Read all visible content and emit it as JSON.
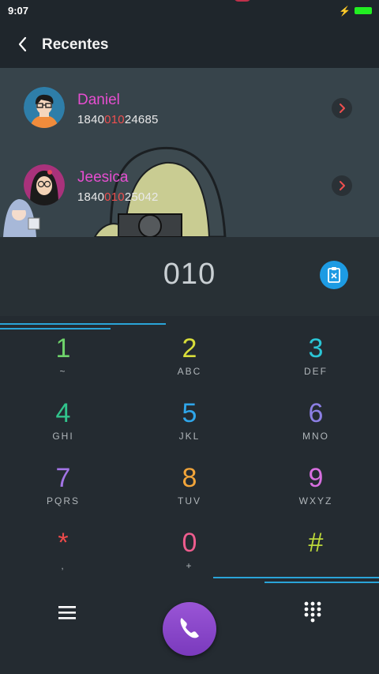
{
  "status": {
    "time": "9:07"
  },
  "header": {
    "title": "Recentes"
  },
  "contacts": [
    {
      "name": "Daniel",
      "number_pre": "1840",
      "number_match": "010",
      "number_post": "24685"
    },
    {
      "name": "Jeesica",
      "number_pre": "1840",
      "number_match": "010",
      "number_post": "25042"
    }
  ],
  "dialer": {
    "entered": "010"
  },
  "keypad": [
    {
      "digit": "1",
      "letters": "~",
      "color": "#6fd36b"
    },
    {
      "digit": "2",
      "letters": "ABC",
      "color": "#d8dd3a"
    },
    {
      "digit": "3",
      "letters": "DEF",
      "color": "#2bc6d6"
    },
    {
      "digit": "4",
      "letters": "GHI",
      "color": "#31c48c"
    },
    {
      "digit": "5",
      "letters": "JKL",
      "color": "#2fa6ea"
    },
    {
      "digit": "6",
      "letters": "MNO",
      "color": "#8c7fe4"
    },
    {
      "digit": "7",
      "letters": "PQRS",
      "color": "#a374e6"
    },
    {
      "digit": "8",
      "letters": "TUV",
      "color": "#f2a53a"
    },
    {
      "digit": "9",
      "letters": "WXYZ",
      "color": "#d86fe0"
    },
    {
      "digit": "*",
      "letters": ",",
      "color": "#ee4a4a"
    },
    {
      "digit": "0",
      "letters": "+",
      "color": "#ee5d8e"
    },
    {
      "digit": "#",
      "letters": "",
      "color": "#bcd83a"
    }
  ],
  "icons": {
    "back": "chevron-left-icon",
    "clipboard": "clipboard-icon",
    "menu": "menu-icon",
    "call": "phone-icon",
    "dialpad": "dialpad-icon"
  }
}
